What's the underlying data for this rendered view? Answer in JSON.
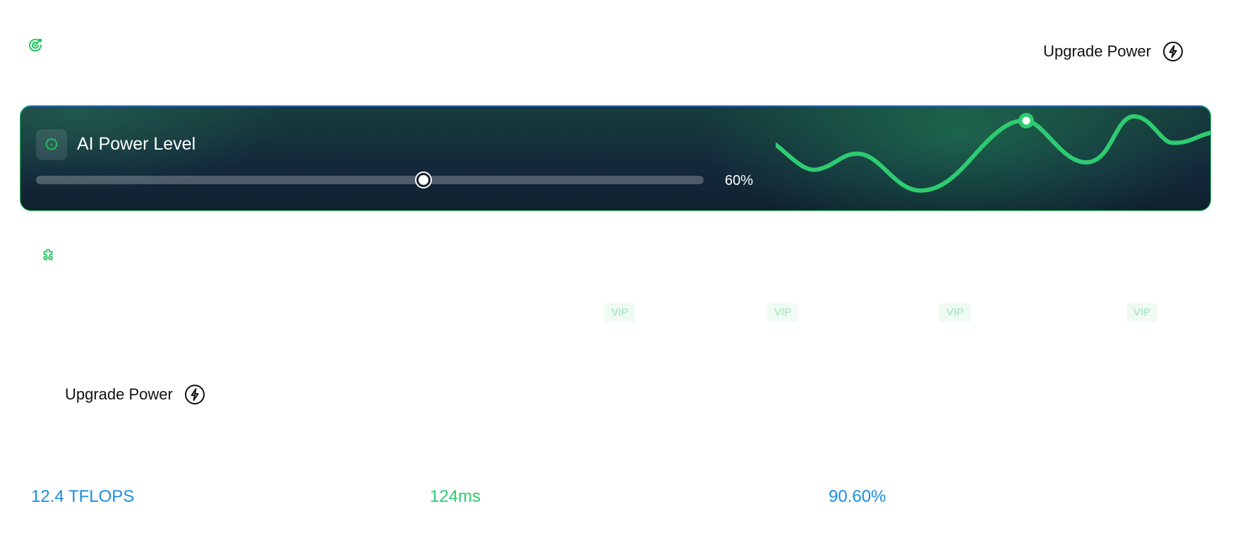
{
  "colors": {
    "accent_green": "#22c55e",
    "accent_blue": "#1a8fe0",
    "card_dark": "#13283a"
  },
  "icons": {
    "top_left": "target-refresh-icon",
    "card": "gear-bolt-icon",
    "section": "puzzle-icon",
    "upgrade": "lightning-bolt-icon"
  },
  "header": {
    "upgrade_label": "Upgrade Power"
  },
  "power_card": {
    "title": "AI Power Level",
    "level_fraction": 0.58,
    "value_text": "60%"
  },
  "badges": [
    {
      "label": "VIP"
    },
    {
      "label": "VIP"
    },
    {
      "label": "VIP"
    },
    {
      "label": "VIP"
    }
  ],
  "section": {
    "upgrade_label": "Upgrade Power"
  },
  "metrics": [
    {
      "value": "12.4 TFLOPS"
    },
    {
      "value": "124ms"
    },
    {
      "value": "90.60%"
    }
  ]
}
